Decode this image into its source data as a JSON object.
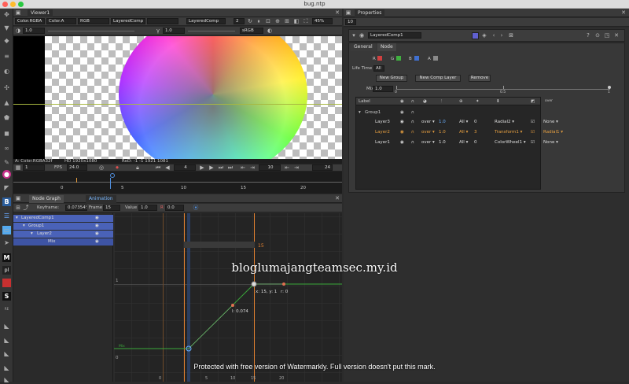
{
  "window": {
    "title": "bug.ntp"
  },
  "viewer": {
    "tab": "Viewer1",
    "channels": "Color.RGBA",
    "alpha": "Color.A",
    "colorspace": "RGB",
    "input_a": "LayeredComp",
    "input_b": "LayeredComp",
    "zoom_level": "2",
    "zoom_pct": "45%",
    "gain": "1.0",
    "gamma": "1.0",
    "lut": "sRGB",
    "info_left": "A: Color.RGBA32f",
    "info_mid": "HD 1920x1080",
    "info_right": "RoD: -1 -1 1921 1081",
    "proxy": "1",
    "fps_label": "FPS",
    "fps_value": "24.0",
    "current_frame": "4",
    "playback_step": "10",
    "end_frame": "24",
    "ruler_ticks": [
      "0",
      "5",
      "10",
      "15",
      "20"
    ]
  },
  "properties": {
    "tab": "Properties",
    "max_panels": "10",
    "node_name": "LayeredComp1",
    "tabs": [
      "General",
      "Node"
    ],
    "channels": [
      {
        "label": "R",
        "color": "#d04040"
      },
      {
        "label": "G",
        "color": "#40b040"
      },
      {
        "label": "B",
        "color": "#4070d0"
      },
      {
        "label": "A",
        "color": "#8a8a8a"
      }
    ],
    "life_time_label": "Life Time",
    "life_time_value": "All",
    "buttons": {
      "new_group": "New Group",
      "new_comp_layer": "New Comp Layer",
      "remove": "Remove"
    },
    "mix_label": "Mix",
    "mix_value": "1.0",
    "mix_scale": [
      "0",
      "0.5",
      "1"
    ],
    "table_header": {
      "label": "Label",
      "tail": "over"
    },
    "group": "Group1",
    "layers": [
      {
        "name": "Layer3",
        "op": "over",
        "mix": "1.0",
        "chan": "All",
        "lt": "0",
        "source": "Radial2",
        "mask": "None",
        "highlight": false,
        "blue_mix": true
      },
      {
        "name": "Layer2",
        "op": "over",
        "mix": "1.0",
        "chan": "All",
        "lt": "3",
        "source": "Transform1",
        "mask": "Radial1",
        "highlight": true,
        "blue_mix": false
      },
      {
        "name": "Layer1",
        "op": "over",
        "mix": "1.0",
        "chan": "All",
        "lt": "0",
        "source": "ColorWheel1",
        "mask": "None",
        "highlight": false,
        "blue_mix": false
      }
    ]
  },
  "graph": {
    "tab_node": "Node Graph",
    "tab_anim": "Animation",
    "keyframe_label": "Keyframe:",
    "keyframe_value": "0.073545",
    "frame_label": "Frame",
    "frame_value": "15",
    "value_label": "Value",
    "value_value": "1.0",
    "r_label": "R",
    "r_value": "0.0",
    "tree": [
      "LayeredComp1",
      "Group1",
      "Layer2",
      "Mix"
    ],
    "range_value": "15",
    "key_label": "x: 15, y: 1",
    "r_readout": "r: 0",
    "l_readout": "l: 0.074",
    "y_ticks": [
      "1",
      "0"
    ],
    "mix_axis": "Mix",
    "frame_ticks": [
      "0",
      "5",
      "10",
      "15",
      "20"
    ]
  },
  "watermark": {
    "site": "bloglumajangteamsec.my.id",
    "notice": "Protected with free version of Watermarkly. Full version doesn't put this mark."
  }
}
